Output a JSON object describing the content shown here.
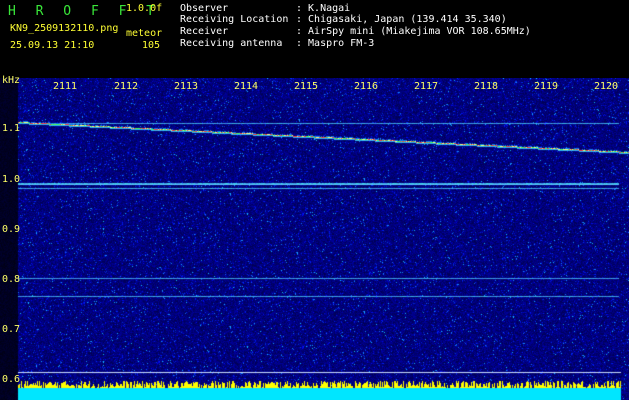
{
  "header": {
    "brand": "H R O F F T",
    "version": "1.0.0f",
    "filename": "KN9_2509132110.png",
    "mode_label": "meteor",
    "timestamp": "25.09.13 21:10",
    "count": "105",
    "fields": [
      {
        "label": "Observer",
        "value": ": K.Nagai"
      },
      {
        "label": "Receiving Location",
        "value": ": Chigasaki, Japan (139.414 35.340)"
      },
      {
        "label": "Receiver",
        "value": ": AirSpy mini (Miakejima VOR 108.65MHz)"
      },
      {
        "label": "Receiving antenna",
        "value": ": Maspro FM-3"
      }
    ]
  },
  "axes": {
    "y_unit": "kHz",
    "y_ticks": [
      "1.1",
      "1.0",
      "0.9",
      "0.8",
      "0.7",
      "0.6"
    ],
    "x_ticks": [
      "2111",
      "2112",
      "2113",
      "2114",
      "2115",
      "2116",
      "2117",
      "2118",
      "2119",
      "2120"
    ]
  },
  "colors": {
    "background": "#000000",
    "label_green": "#39e639",
    "label_yellow": "#ffff33",
    "waterfall_base": "#00007a",
    "baseline_band": "#00ffff"
  }
}
